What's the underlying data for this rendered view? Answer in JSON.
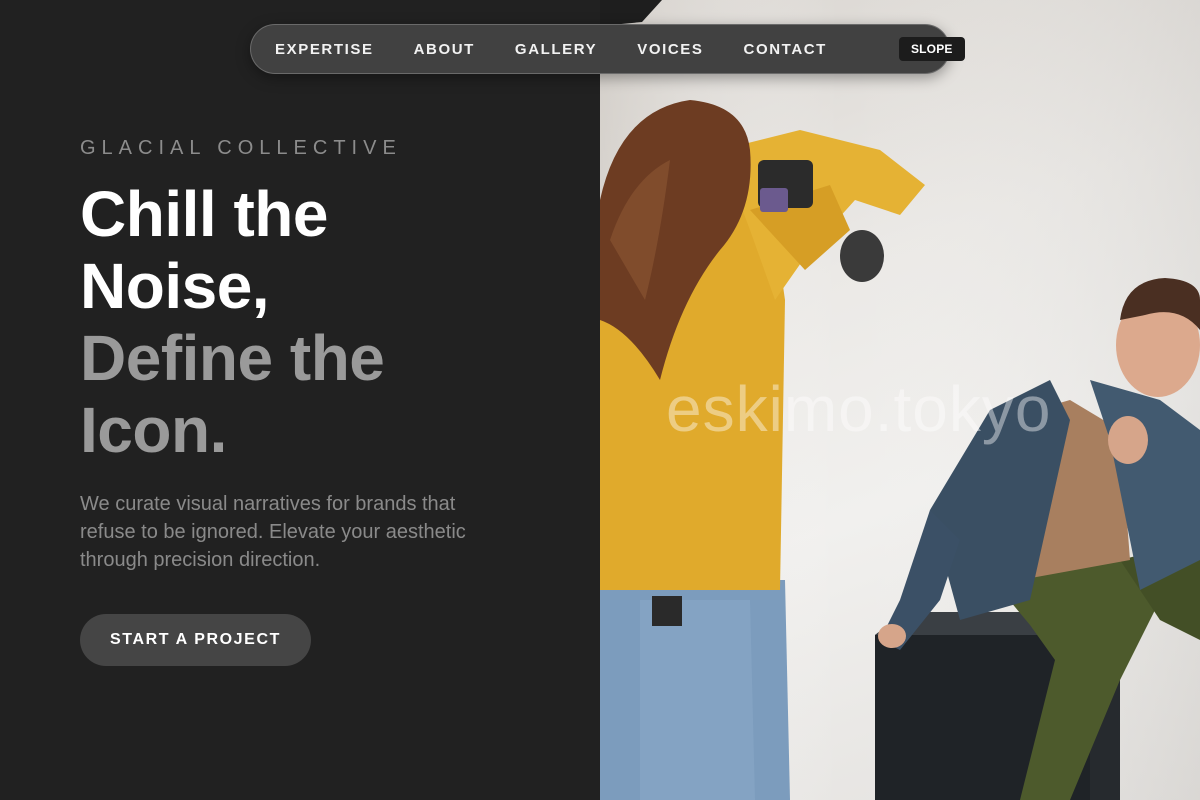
{
  "nav": {
    "links": [
      "EXPERTISE",
      "ABOUT",
      "GALLERY",
      "VOICES",
      "CONTACT"
    ],
    "brand": "SLOPE"
  },
  "hero": {
    "eyebrow": "GLACIAL COLLECTIVE",
    "headline_line1": "Chill the",
    "headline_line2": "Noise,",
    "headline_line3": "Define the",
    "headline_line4": "Icon.",
    "description": "We curate visual narratives for brands that refuse to be ignored. Elevate your aesthetic through precision direction.",
    "cta_label": "START A PROJECT"
  },
  "photo": {
    "watermark": "eskimo.tokyo",
    "subject": "photographer-shooting-model"
  },
  "colors": {
    "background": "#212121",
    "nav_background": "#414141",
    "headline_primary": "#ffffff",
    "headline_secondary": "#9a9a9a",
    "cta_background": "#454545"
  }
}
